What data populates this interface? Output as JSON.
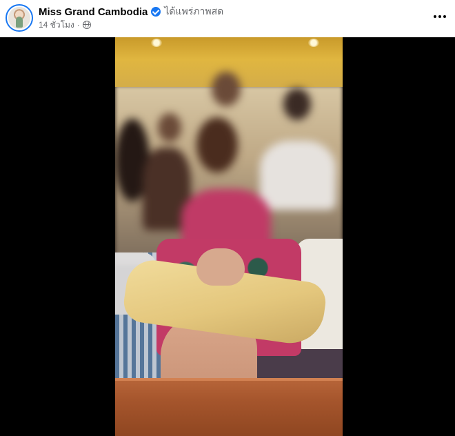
{
  "post": {
    "page_name": "Miss Grand Cambodia",
    "live_text": "ได้แพร่ภาพสด",
    "time": "14 ชั่วโมง",
    "separator": "·"
  },
  "icons": {
    "verified": "verified-badge-icon",
    "audience": "globe-icon",
    "more": "more-options-icon"
  },
  "colors": {
    "accent": "#1877f2",
    "secondary_text": "#65676b",
    "primary_text": "#050505",
    "video_background": "#000000"
  }
}
